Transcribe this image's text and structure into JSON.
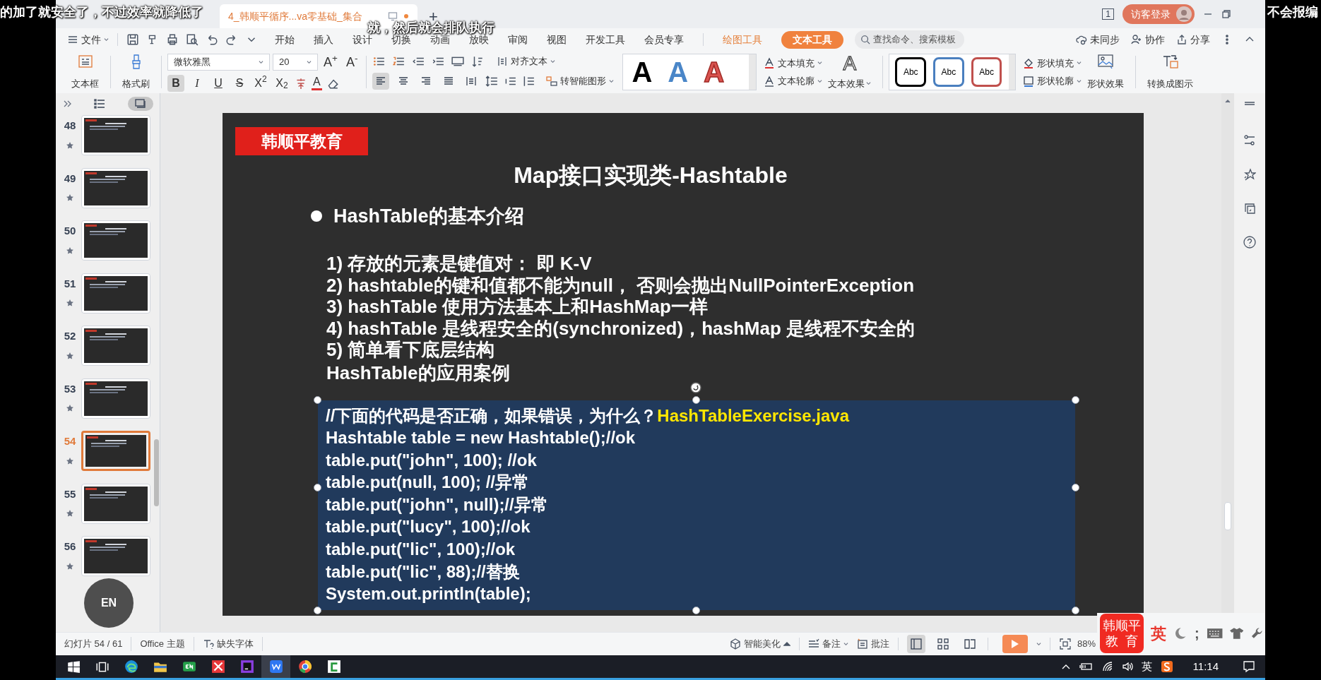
{
  "subtitles": [
    "的加了就安全了，不过效率就降低了",
    "就，然后就会排队执行",
    "不会报编"
  ],
  "title_bar": {
    "tabs": [
      {
        "label": "4_韩顺平循序...va零基础_集合",
        "selected": true,
        "unsaved": true
      }
    ],
    "new_tab": "+",
    "window_count": "1",
    "login": "访客登录"
  },
  "menu": {
    "file": "文件",
    "tabs": [
      {
        "label": "开始",
        "kind": "main",
        "selected": false
      },
      {
        "label": "插入",
        "kind": "main",
        "selected": false
      },
      {
        "label": "设计",
        "kind": "main",
        "selected": false
      },
      {
        "label": "切换",
        "kind": "main",
        "selected": false
      },
      {
        "label": "动画",
        "kind": "main",
        "selected": false
      },
      {
        "label": "放映",
        "kind": "main",
        "selected": false
      },
      {
        "label": "审阅",
        "kind": "main",
        "selected": false
      },
      {
        "label": "视图",
        "kind": "main",
        "selected": false
      },
      {
        "label": "开发工具",
        "kind": "main",
        "selected": false
      },
      {
        "label": "会员专享",
        "kind": "main",
        "selected": false
      },
      {
        "label": "绘图工具",
        "kind": "context",
        "selected": false
      },
      {
        "label": "文本工具",
        "kind": "context",
        "selected": true
      }
    ],
    "search": {
      "placeholder": "查找命令、搜索模板"
    },
    "actions": [
      {
        "label": "未同步",
        "kind": "sync"
      },
      {
        "label": "协作",
        "kind": "people"
      },
      {
        "label": "分享",
        "kind": "share"
      }
    ]
  },
  "ribbon": {
    "text_box": "文本框",
    "format_painter": "格式刷",
    "font": {
      "family": "微软雅黑",
      "size": "20"
    },
    "grow": "A$^{+}$",
    "shrink": "A$^{-}$",
    "format": [
      {
        "label": "B",
        "kind": "bold",
        "on": true
      },
      {
        "label": "I",
        "kind": "italic",
        "on": false
      },
      {
        "label": "U",
        "kind": "underline",
        "on": false
      },
      {
        "label": "S",
        "kind": "strike",
        "on": false
      },
      {
        "label": "X$^{2}$",
        "kind": "plain",
        "on": false
      },
      {
        "label": "X$_{2}$",
        "kind": "plain",
        "on": false
      }
    ],
    "font_color": "A",
    "align": [
      {
        "kind": "left",
        "selected": true
      },
      {
        "kind": "center",
        "selected": false
      },
      {
        "kind": "right",
        "selected": false
      },
      {
        "kind": "justify",
        "selected": false
      },
      {
        "kind": "distributed",
        "selected": false
      }
    ],
    "align_text": "对齐文本",
    "smart_art": "转智能图形",
    "text_styles": [
      {
        "label": "A",
        "kind": "solid",
        "color": "#000000"
      },
      {
        "label": "A",
        "kind": "solid",
        "color": "#4a86c8"
      },
      {
        "label": "A",
        "kind": "outline",
        "color": "#d9534f"
      }
    ],
    "text_fill": "文本填充",
    "text_outline": "文本轮廓",
    "text_effects_glyph": "A",
    "text_effects": "文本效果",
    "shape_styles": [
      {
        "label": "Abc",
        "color": "#000000"
      },
      {
        "label": "Abc",
        "color": "#4a7fbf"
      },
      {
        "label": "Abc",
        "color": "#c0504d"
      }
    ],
    "shape_fill": "形状填充",
    "shape_outline": "形状轮廓",
    "shape_effects": "形状效果",
    "convert": "转换成图示"
  },
  "slide_panel": {
    "slides": [
      {
        "number": "48",
        "selected": false
      },
      {
        "number": "49",
        "selected": false
      },
      {
        "number": "50",
        "selected": false
      },
      {
        "number": "51",
        "selected": false
      },
      {
        "number": "52",
        "selected": false
      },
      {
        "number": "53",
        "selected": false
      },
      {
        "number": "54",
        "selected": true
      },
      {
        "number": "55",
        "selected": false
      },
      {
        "number": "56",
        "selected": false
      }
    ],
    "views": [
      {
        "kind": "outline",
        "selected": false
      },
      {
        "kind": "thumbnails",
        "selected": true
      }
    ],
    "floating_button": "EN"
  },
  "slide": {
    "brand": "韩顺平教育",
    "title": "Map接口实现类-Hashtable",
    "heading": "HashTable的基本介绍",
    "points": [
      "1) 存放的元素是键值对： 即 K-V",
      "2) hashtable的键和值都不能为null， 否则会抛出NullPointerException",
      "3) hashTable 使用方法基本上和HashMap一样",
      "4) hashTable 是线程安全的(synchronized)，hashMap 是线程不安全的",
      "5) 简单看下底层结构"
    ],
    "subheading": "HashTable的应用案例",
    "code": [
      {
        "text": "//下面的代码是否正确，如果错误，为什么？",
        "file": "HashTableExercise.java"
      },
      {
        "text": "Hashtable table = new Hashtable();//ok"
      },
      {
        "text": "table.put(\"john\", 100); //ok"
      },
      {
        "text": "table.put(null, 100); //异常"
      },
      {
        "text": "table.put(\"john\", null);//异常"
      },
      {
        "text": "table.put(\"lucy\", 100);//ok"
      },
      {
        "text": "table.put(\"lic\", 100);//ok"
      },
      {
        "text": "table.put(\"lic\", 88);//替换"
      },
      {
        "text": "System.out.println(table);"
      }
    ]
  },
  "status_bar": {
    "slide_count": "幻灯片 54 / 61",
    "theme": "Office 主题",
    "missing_fonts": "缺失字体",
    "beautify": "智能美化",
    "notes": "备注",
    "comments": "批注",
    "views": [
      {
        "kind": "normal",
        "selected": true
      },
      {
        "kind": "sorter",
        "selected": false
      },
      {
        "kind": "reading",
        "selected": false
      }
    ],
    "zoom": "88%"
  },
  "ime_widget": {
    "brand": [
      "韩顺平",
      "教  育"
    ],
    "mode": "英",
    "punct": ";"
  },
  "taskbar": {
    "apps": [
      {
        "kind": "windows",
        "selected": false
      },
      {
        "kind": "taskview",
        "selected": false
      },
      {
        "kind": "edge",
        "selected": false
      },
      {
        "kind": "folder",
        "selected": false
      },
      {
        "kind": "en",
        "selected": false
      },
      {
        "kind": "xmind",
        "selected": false
      },
      {
        "kind": "ide",
        "selected": false
      },
      {
        "kind": "wps",
        "selected": true
      },
      {
        "kind": "chrome",
        "selected": false
      },
      {
        "kind": "camtasia",
        "selected": false
      }
    ],
    "ime": "英",
    "time": "11:14"
  }
}
